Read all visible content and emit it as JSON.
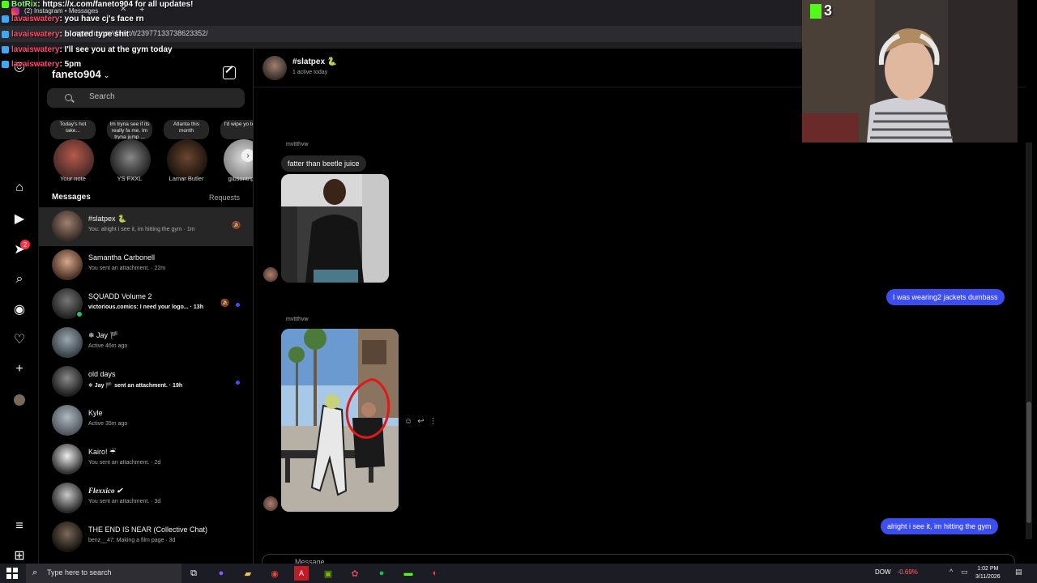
{
  "browser": {
    "tab_title": "(2) Instagram • Messages",
    "url": "https://www.instagram.com/direct/t/23977133738623352/",
    "url_visible": "agram.com/direct/t/23977133738623352/"
  },
  "stream_chat": [
    {
      "name": "BotRix",
      "message": ": https://x.com/faneto904 for all updates!",
      "bot": true
    },
    {
      "name": "lavaiswatery",
      "message": ": you have cj's face rn",
      "bot": false
    },
    {
      "name": "lavaiswatery",
      "message": ": bloated type shit",
      "bot": false
    },
    {
      "name": "lavaiswatery",
      "message": ": I'll see you at the gym today",
      "bot": false
    },
    {
      "name": "lavaiswatery",
      "message": ": 5pm",
      "bot": false
    }
  ],
  "stream_overlay": {
    "viewer_count": "3"
  },
  "inbox": {
    "account_name": "faneto904",
    "search_placeholder": "Search",
    "notes": [
      {
        "bubble": "Today's hot take...",
        "name": "Your note"
      },
      {
        "bubble": "Im tryna see if its really fa me. Im tryna jump ...",
        "name": "YS FXXL"
      },
      {
        "bubble": "Atlanta this month",
        "name": "Lamar Butler"
      },
      {
        "bubble": "I'd wipe yo tears",
        "name": "gibsontripp"
      }
    ],
    "messages_label": "Messages",
    "requests_label": "Requests",
    "threads": [
      {
        "name": "#slatpex 🐍",
        "sub": "You: alright i see it, im hitting the gym · 1m",
        "active": true,
        "muted": true,
        "unread": false,
        "online": false
      },
      {
        "name": "Samantha Carbonell",
        "sub": "You sent an attachment. · 22m",
        "active": false,
        "muted": false,
        "unread": false,
        "online": false
      },
      {
        "name": "SQUADD Volume 2",
        "sub": "victorious.comics: I need your logo... · 13h",
        "active": false,
        "muted": true,
        "unread": true,
        "online": true
      },
      {
        "name": "❄ Jay 🏴",
        "sub": "Active 46m ago",
        "active": false,
        "muted": false,
        "unread": false,
        "online": false
      },
      {
        "name": "old days",
        "sub": "❄ Jay 🏴 sent an attachment. · 19h",
        "active": false,
        "muted": false,
        "unread": true,
        "online": false
      },
      {
        "name": "Kyle",
        "sub": "Active 35m ago",
        "active": false,
        "muted": false,
        "unread": false,
        "online": false
      },
      {
        "name": "Kairo! ☔",
        "sub": "You sent an attachment. · 2d",
        "active": false,
        "muted": false,
        "unread": false,
        "online": false
      },
      {
        "name": "Flexxico ✔",
        "sub": "You sent an attachment. · 3d",
        "active": false,
        "muted": false,
        "unread": false,
        "online": false
      },
      {
        "name": "THE END IS NEAR (Collective Chat)",
        "sub": "benz__47: Making a film page · 3d",
        "active": false,
        "muted": false,
        "unread": false,
        "online": false
      }
    ]
  },
  "rail": {
    "icons": [
      "instagram-icon",
      "home-icon",
      "reels-icon",
      "messages-icon",
      "search-icon",
      "explore-icon",
      "heart-icon",
      "create-icon",
      "profile-avatar",
      "menu-icon",
      "more-icon"
    ],
    "badge": "2"
  },
  "chat": {
    "name": "#slatpex 🐍",
    "status": "1 active today",
    "sender1": "mvttthvw",
    "msg1": "fatter than beetle juice",
    "sender2": "mvttthvw",
    "reply1": "I was wearing2 jackets dumbass",
    "reply2": "alright i see it, im hitting the gym",
    "composer_placeholder": "Message..."
  },
  "taskbar": {
    "search_placeholder": "Type here to search",
    "stock_name": "DOW",
    "stock_change": "-0.69%",
    "time": "1:02 PM",
    "date": "3/11/2026"
  },
  "colors": {
    "accent_blue": "#3d4ef0",
    "kick_green": "#53fc18",
    "unread_dot": "#4150f7"
  }
}
